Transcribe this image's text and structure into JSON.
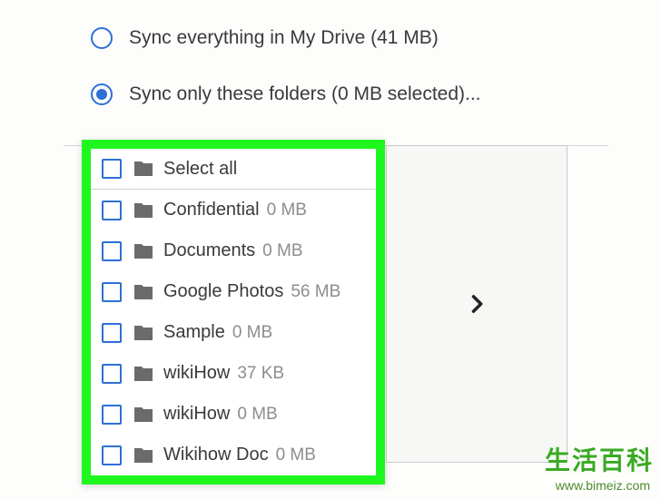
{
  "radios": {
    "sync_all": {
      "label": "Sync everything in My Drive (41 MB)",
      "selected": false
    },
    "sync_only": {
      "label": "Sync only these folders (0 MB selected)...",
      "selected": true
    }
  },
  "select_all_label": "Select all",
  "folders": [
    {
      "name": "Confidential",
      "size": "0 MB"
    },
    {
      "name": "Documents",
      "size": "0 MB"
    },
    {
      "name": "Google Photos",
      "size": "56 MB"
    },
    {
      "name": "Sample",
      "size": "0 MB"
    },
    {
      "name": "wikiHow",
      "size": "37 KB"
    },
    {
      "name": "wikiHow",
      "size": "0 MB"
    },
    {
      "name": "Wikihow Doc",
      "size": "0 MB"
    }
  ],
  "watermark": {
    "cn": "生活百科",
    "url": "www.bimeiz.com"
  }
}
